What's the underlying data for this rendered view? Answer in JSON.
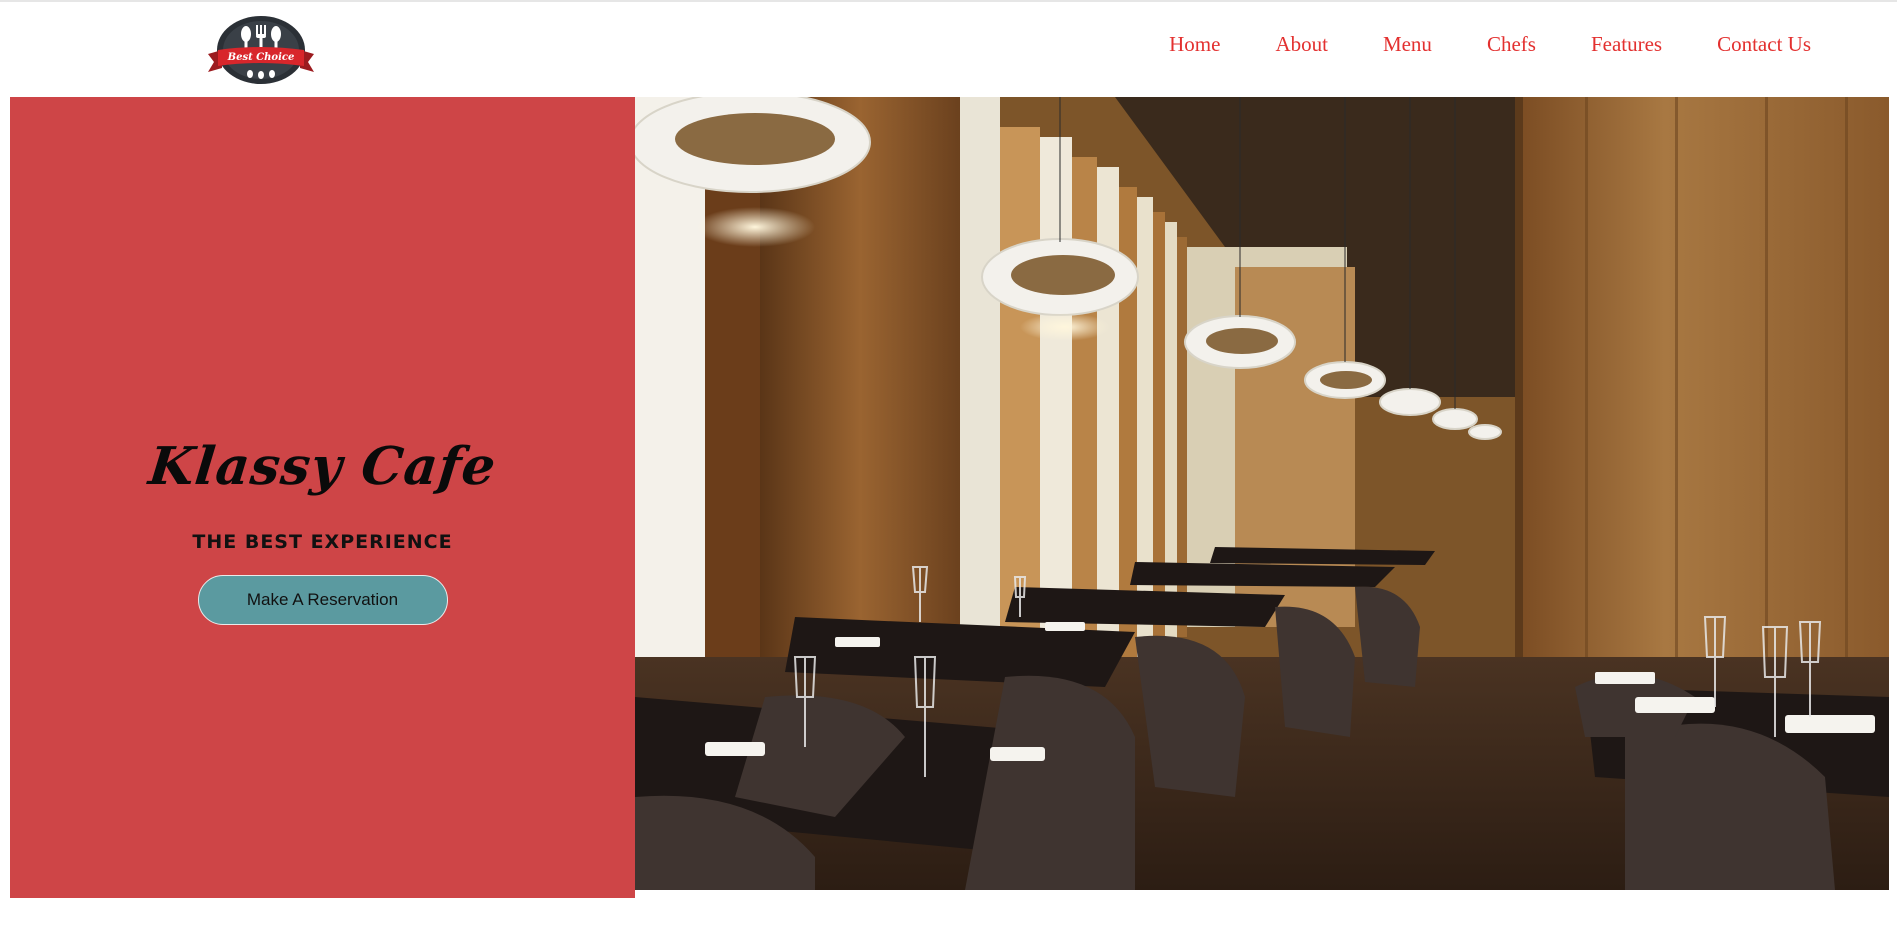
{
  "brand": {
    "logo_text": "Best Choice",
    "colors": {
      "accent_red": "#e3302f",
      "hero_red": "#ce4547",
      "button_teal": "#5b9aa0"
    }
  },
  "nav": {
    "items": [
      {
        "label": "Home"
      },
      {
        "label": "About"
      },
      {
        "label": "Menu"
      },
      {
        "label": "Chefs"
      },
      {
        "label": "Features"
      },
      {
        "label": "Contact Us"
      }
    ]
  },
  "hero": {
    "title": "Klassy Cafe",
    "subtitle": "THE BEST EXPERIENCE",
    "cta_label": "Make A Reservation"
  },
  "icons": [
    "spoon-icon",
    "fork-icon",
    "restaurant-photo"
  ]
}
